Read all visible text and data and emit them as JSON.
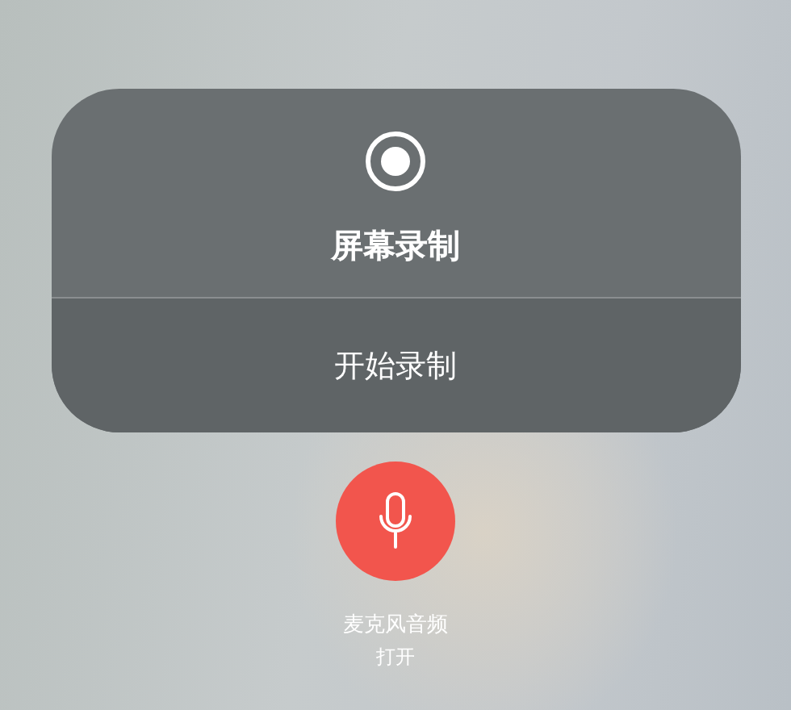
{
  "panel": {
    "title": "屏幕录制",
    "action": "开始录制"
  },
  "microphone": {
    "label": "麦克风音频",
    "status": "打开",
    "on": true
  }
}
